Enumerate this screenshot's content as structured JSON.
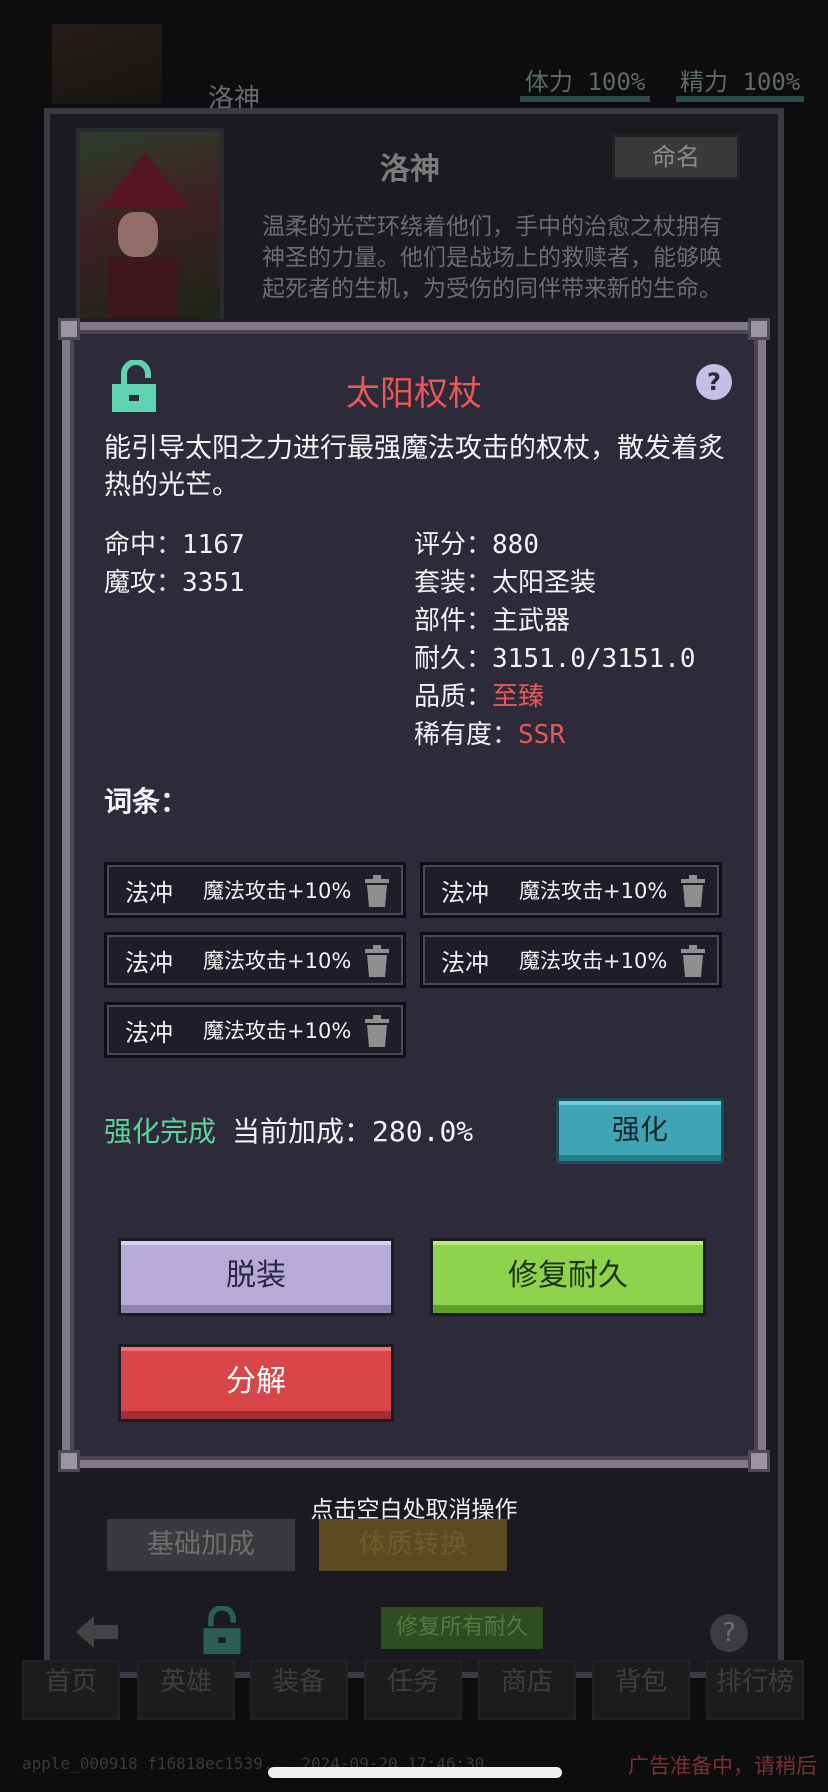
{
  "background": {
    "hero_name": "洛神",
    "stat_stamina": "体力 100%",
    "stat_energy": "精力 100%",
    "panel_title": "洛神",
    "rename_button": "命名",
    "hero_description": "温柔的光芒环绕着他们，手中的治愈之杖拥有神圣的力量。他们是战场上的救赎者，能够唤起死者的生机，为受伤的同伴带来新的生命。",
    "btn_base_bonus": "基础加成",
    "btn_constitution": "体质转换",
    "btn_repair_all": "修复所有耐久",
    "help_label": "?",
    "tabs": [
      "首页",
      "英雄",
      "装备",
      "任务",
      "商店",
      "背包",
      "排行榜"
    ],
    "footer_id": "apple_000918 f16818ec1539... 2024-09-20 17:46:30",
    "ad_status": "广告准备中，请稍后"
  },
  "dismiss_hint": "点击空白处取消操作",
  "item": {
    "name": "太阳权杖",
    "help_label": "?",
    "description": "能引导太阳之力进行最强魔法攻击的权杖，散发着炙热的光芒。",
    "stats_left": [
      {
        "label": "命中：",
        "value": "1167"
      },
      {
        "label": "魔攻：",
        "value": "3351"
      }
    ],
    "stats_right": [
      {
        "label": "评分：",
        "value": "880"
      },
      {
        "label": "套装：",
        "value": "太阳圣装"
      },
      {
        "label": "部件：",
        "value": "主武器"
      },
      {
        "label": "耐久：",
        "value": "3151.0/3151.0"
      },
      {
        "label": "品质：",
        "value": "至臻"
      },
      {
        "label": "稀有度：",
        "value": "SSR"
      }
    ],
    "affix_heading": "词条：",
    "affixes": [
      {
        "name": "法冲",
        "effect": "魔法攻击+10%"
      },
      {
        "name": "法冲",
        "effect": "魔法攻击+10%"
      },
      {
        "name": "法冲",
        "effect": "魔法攻击+10%"
      },
      {
        "name": "法冲",
        "effect": "魔法攻击+10%"
      },
      {
        "name": "法冲",
        "effect": "魔法攻击+10%"
      }
    ],
    "enhance_status": "强化完成",
    "enhance_bonus_label": "当前加成：",
    "enhance_bonus_value": "280.0%",
    "enhance_button": "强化",
    "unequip_button": "脱装",
    "repair_button": "修复耐久",
    "decompose_button": "分解"
  },
  "colors": {
    "dialog_bg": "#2d2b3a",
    "title_red": "#e8575a",
    "enhance_green": "#5fd39b",
    "lock_teal": "#5fd3b0",
    "enhance_button": "#3fa4b5",
    "unequip_button": "#b6abd6",
    "repair_button": "#8ed34b",
    "decompose_button": "#d9464a"
  },
  "icons": {
    "lock": "unlocked-padlock-icon",
    "help": "question-mark-icon",
    "trash": "trash-can-icon",
    "back": "back-arrow-icon"
  }
}
